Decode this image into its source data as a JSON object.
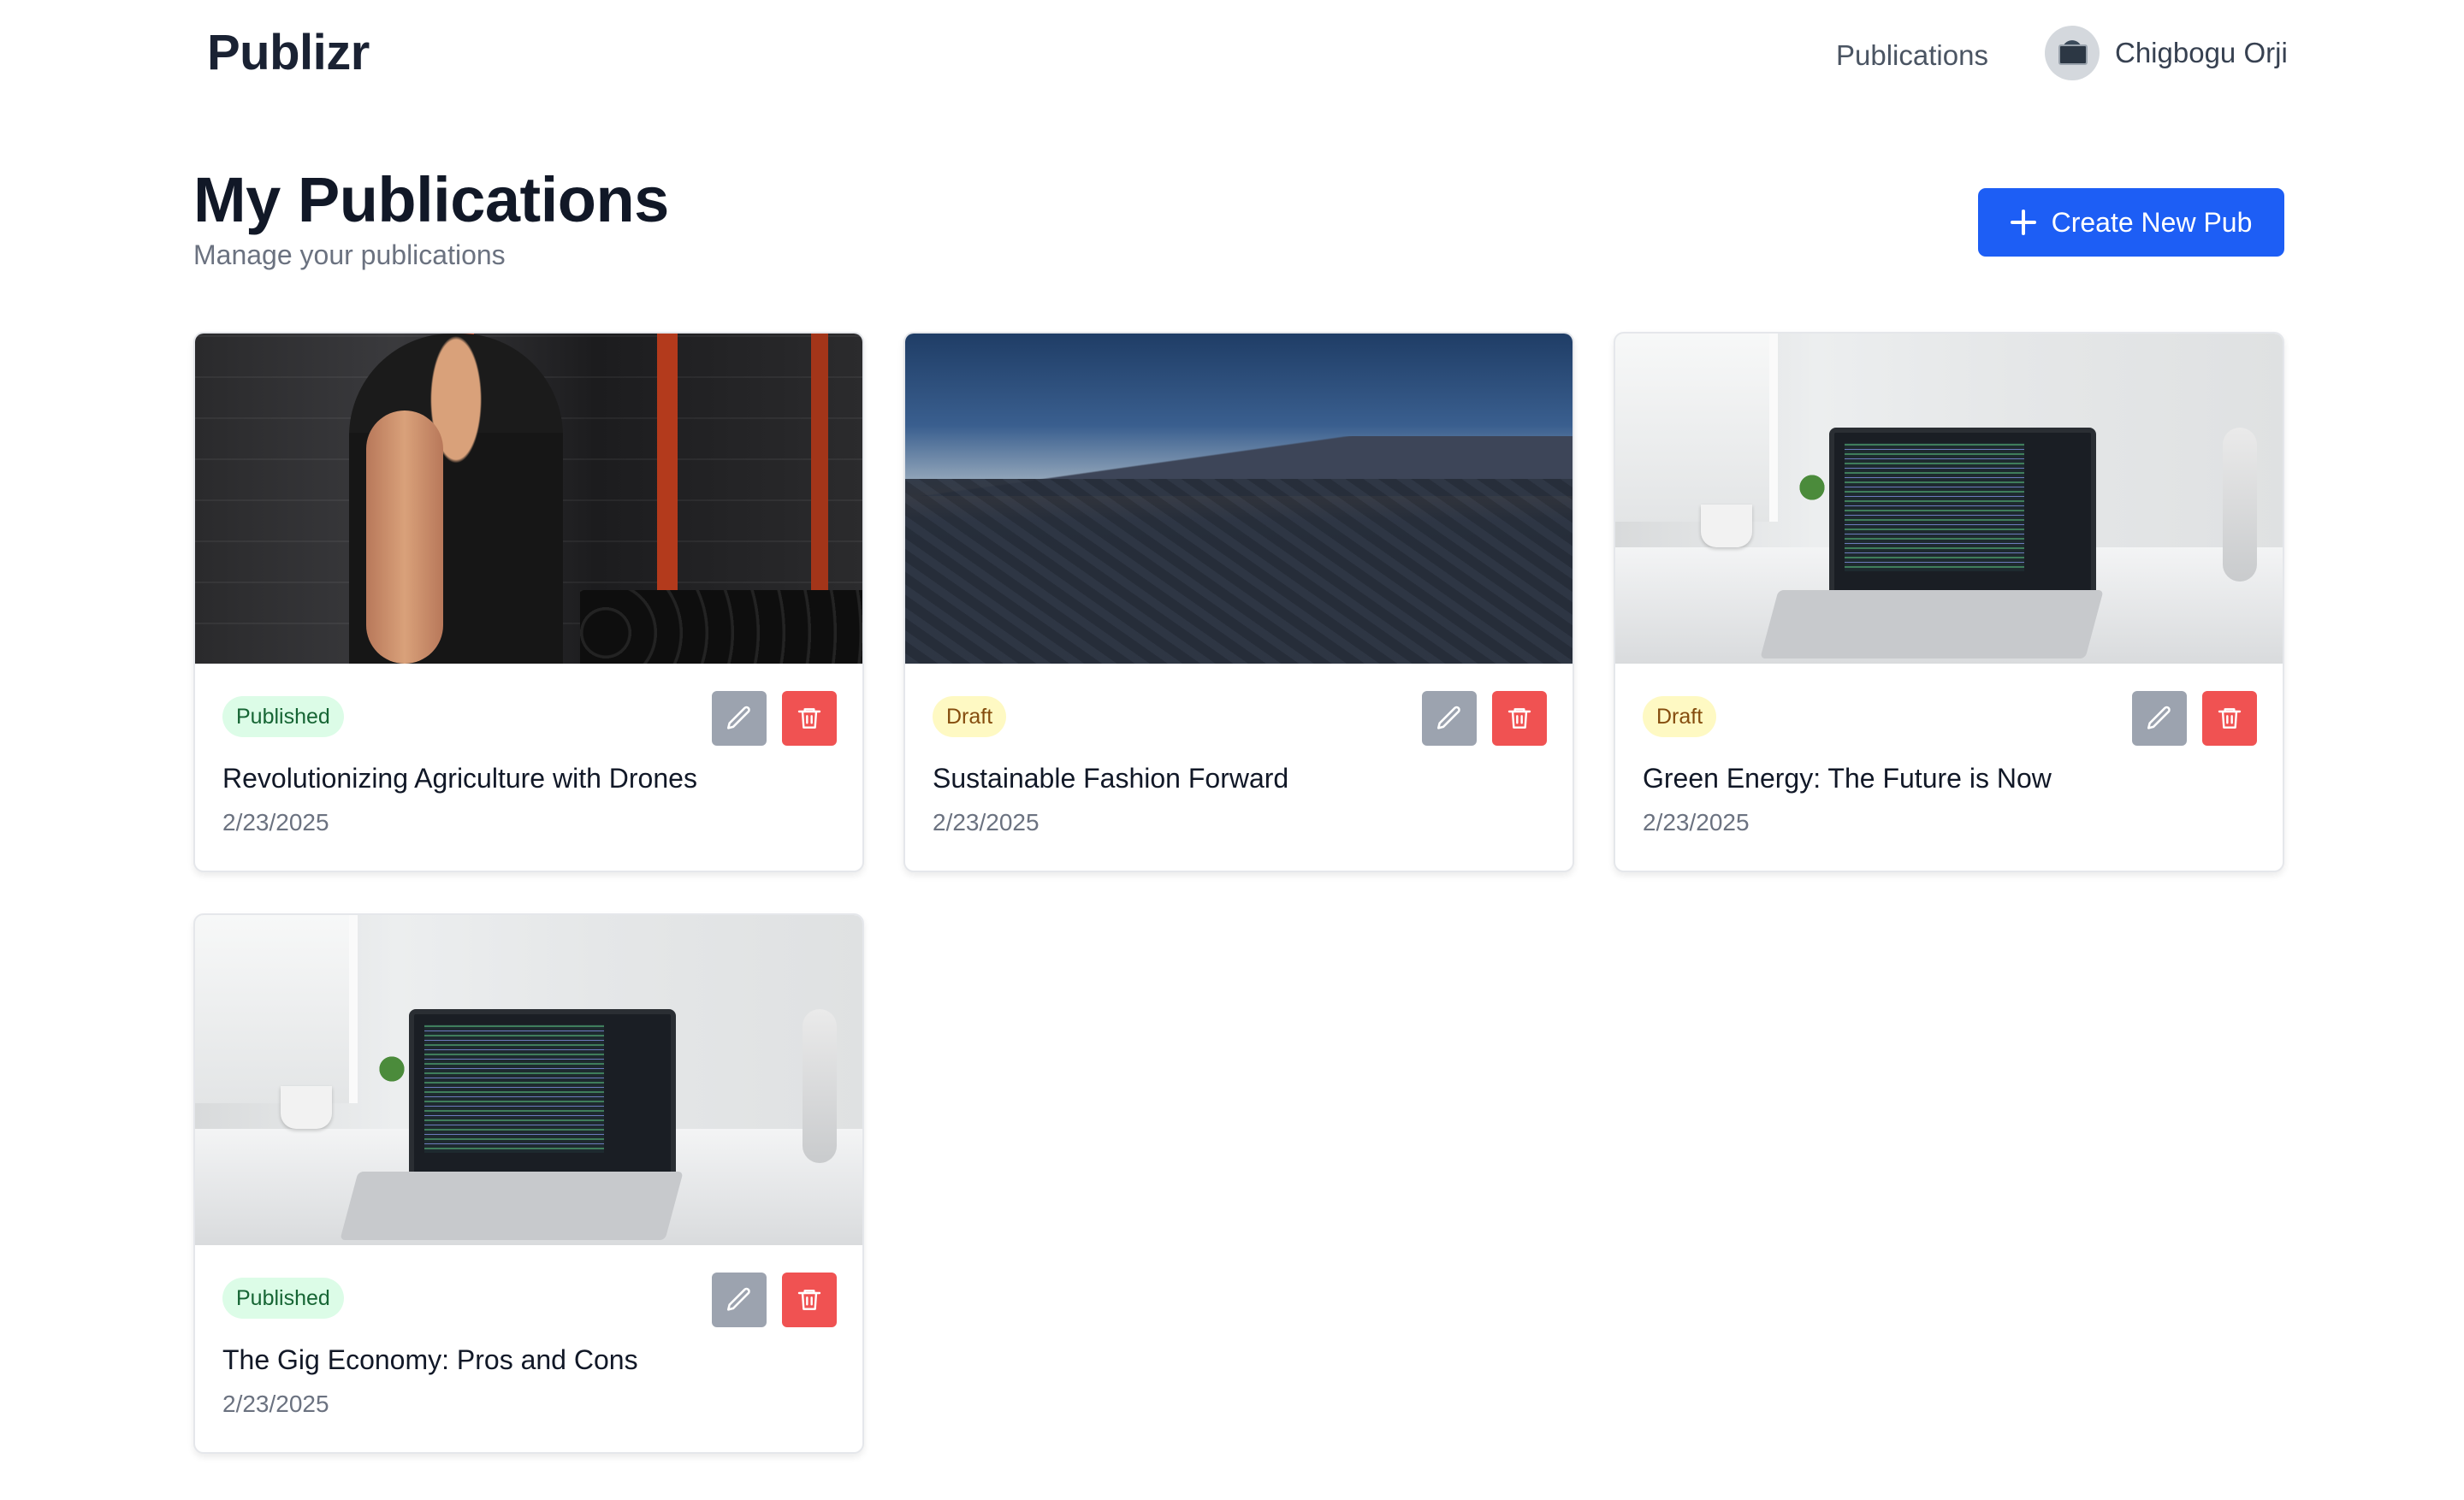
{
  "app": {
    "brand": "Publizr"
  },
  "nav": {
    "publications_link": "Publications",
    "user_name": "Chigbogu Orji"
  },
  "page": {
    "title": "My Publications",
    "subtitle": "Manage your publications",
    "create_button_label": "Create New Pub"
  },
  "colors": {
    "primary": "#1d5ef5",
    "published_badge_bg": "#dcfce7",
    "published_badge_text": "#166534",
    "draft_badge_bg": "#fef9c3",
    "draft_badge_text": "#854d0e",
    "edit_button": "#9ca3af",
    "delete_button": "#f05252"
  },
  "publications": [
    {
      "status": "Published",
      "title": "Revolutionizing Agriculture with Drones",
      "date": "2/23/2025",
      "image": "gym"
    },
    {
      "status": "Draft",
      "title": "Sustainable Fashion Forward",
      "date": "2/23/2025",
      "image": "desert"
    },
    {
      "status": "Draft",
      "title": "Green Energy: The Future is Now",
      "date": "2/23/2025",
      "image": "office"
    },
    {
      "status": "Published",
      "title": "The Gig Economy: Pros and Cons",
      "date": "2/23/2025",
      "image": "office"
    }
  ]
}
